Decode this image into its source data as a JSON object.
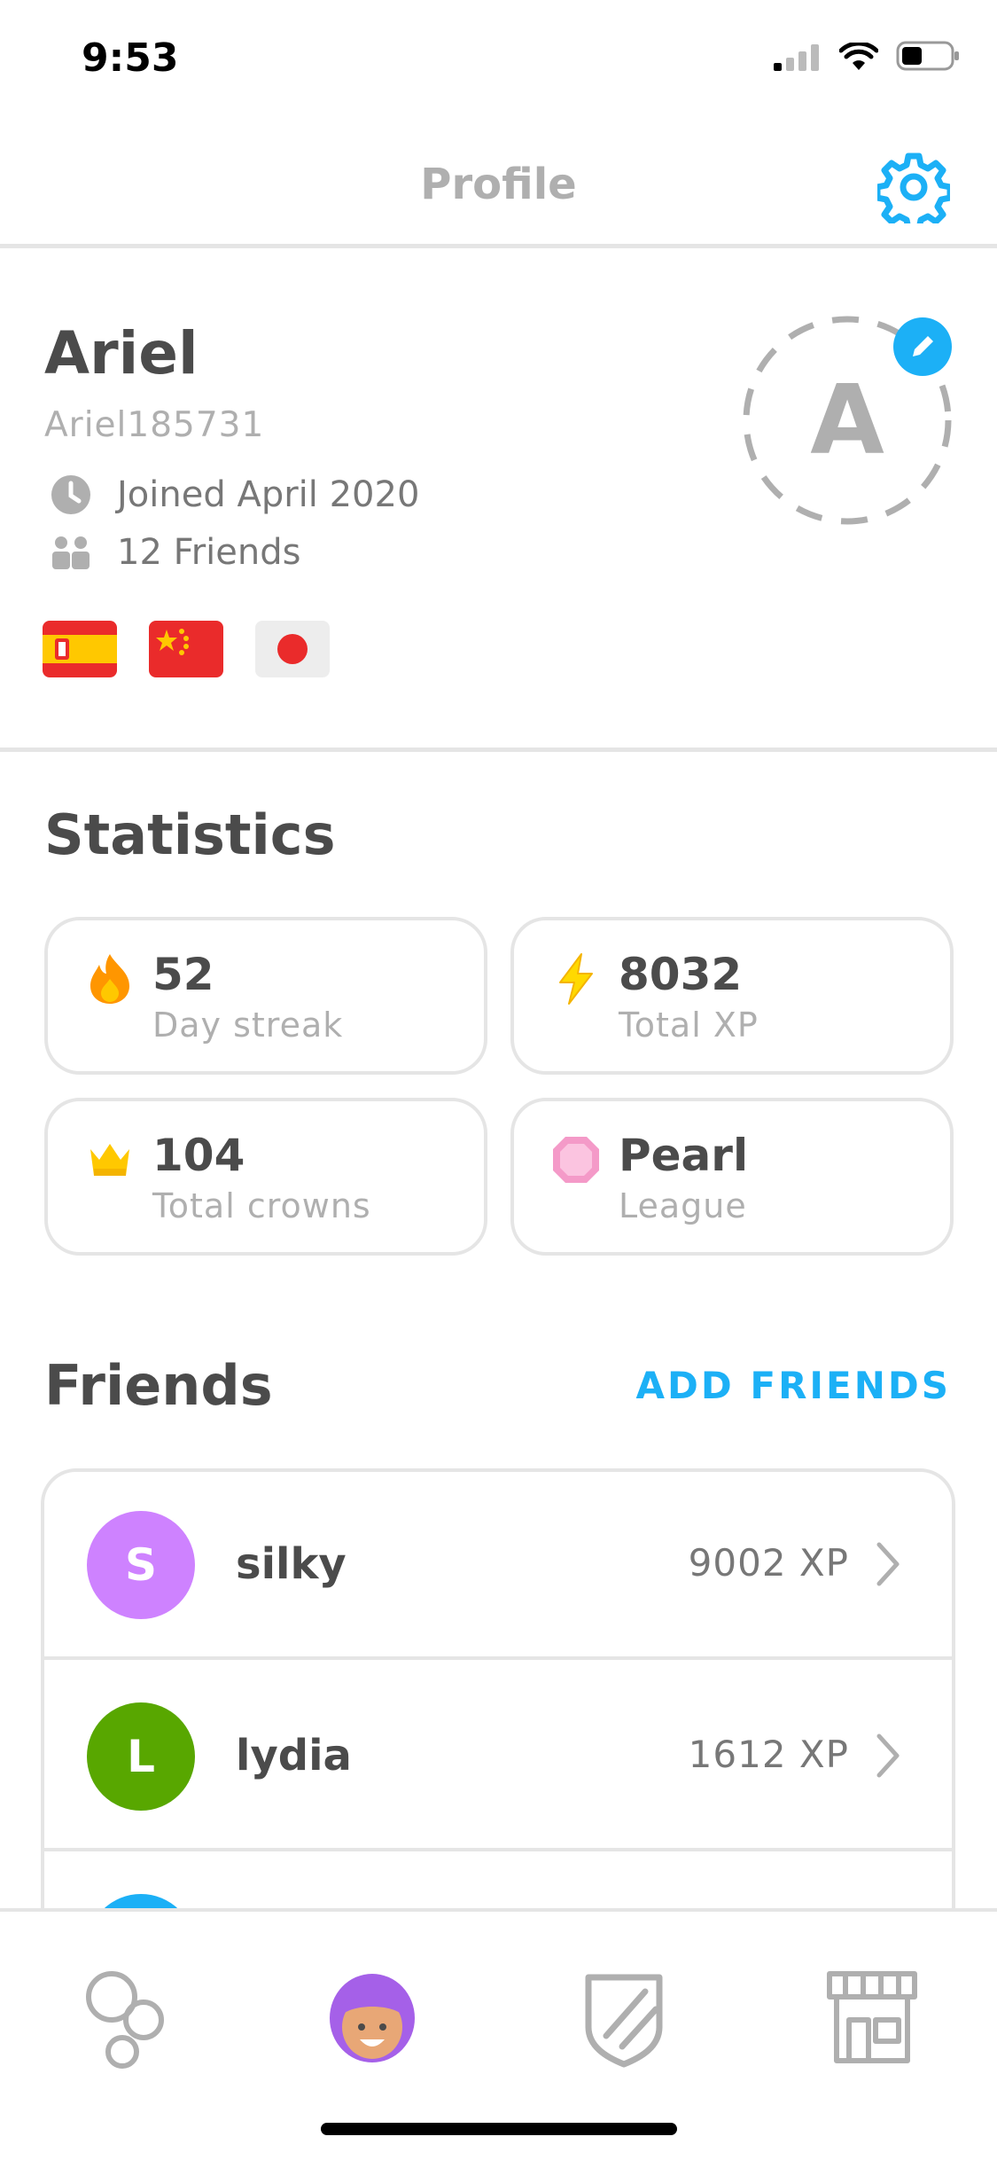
{
  "status_bar": {
    "time": "9:53"
  },
  "header": {
    "title": "Profile"
  },
  "profile": {
    "name": "Ariel",
    "username": "Ariel185731",
    "joined": "Joined April 2020",
    "friends_count": "12 Friends",
    "avatar_letter": "A",
    "flags": [
      "spanish-flag",
      "chinese-flag",
      "japanese-flag"
    ]
  },
  "statistics": {
    "title": "Statistics",
    "cards": [
      {
        "value": "52",
        "label": "Day streak",
        "icon": "fire-icon"
      },
      {
        "value": "8032",
        "label": "Total XP",
        "icon": "lightning-icon"
      },
      {
        "value": "104",
        "label": "Total crowns",
        "icon": "crown-icon"
      },
      {
        "value": "Pearl",
        "label": "League",
        "icon": "pearl-league-icon"
      }
    ]
  },
  "friends": {
    "title": "Friends",
    "add_label": "ADD FRIENDS",
    "list": [
      {
        "initial": "S",
        "name": "silky",
        "xp": "9002 XP",
        "color": "#ce82ff"
      },
      {
        "initial": "L",
        "name": "lydia",
        "xp": "1612 XP",
        "color": "#58a700"
      }
    ]
  },
  "tabbar": {
    "items": [
      "learn-tab",
      "profile-tab",
      "leagues-tab",
      "shop-tab"
    ]
  },
  "colors": {
    "accent": "#1cb0f6",
    "muted": "#afafaf",
    "text": "#4b4b4b",
    "border": "#e5e5e5"
  }
}
